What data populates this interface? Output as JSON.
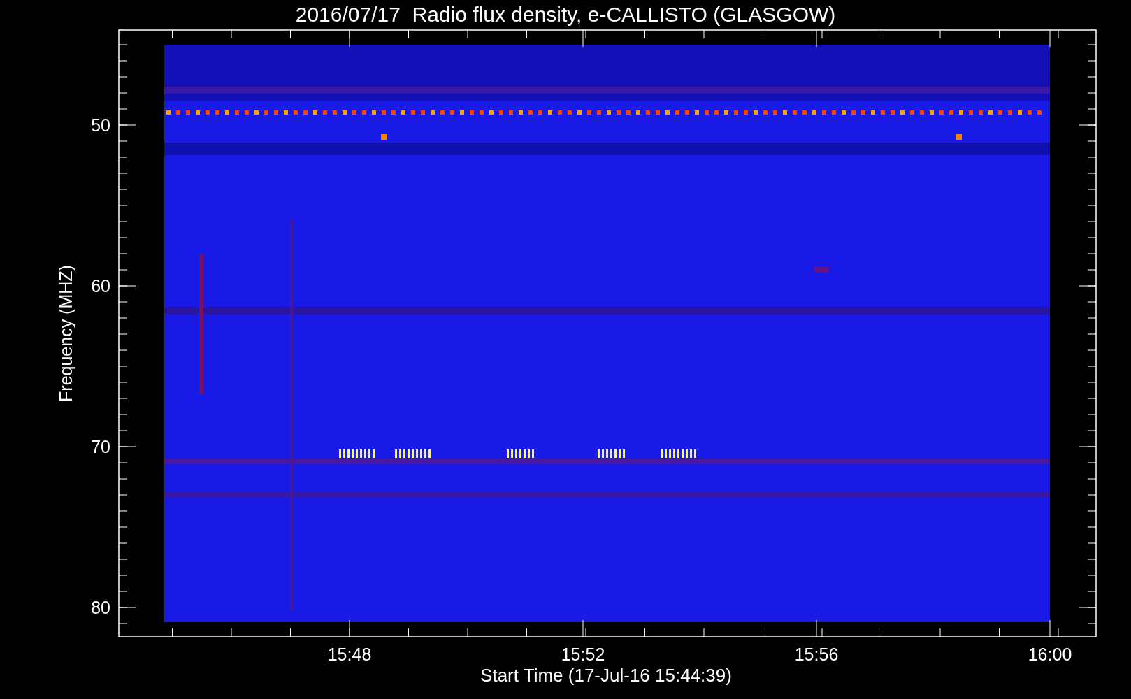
{
  "title": "2016/07/17  Radio flux density, e-CALLISTO (GLASGOW)",
  "y_axis": {
    "label": "Frequency (MHZ)",
    "ticks": [
      "50",
      "60",
      "70",
      "80"
    ]
  },
  "x_axis": {
    "label": "Start Time (17-Jul-16 15:44:39)",
    "ticks": [
      "15:48",
      "15:52",
      "15:56",
      "16:00"
    ]
  }
}
